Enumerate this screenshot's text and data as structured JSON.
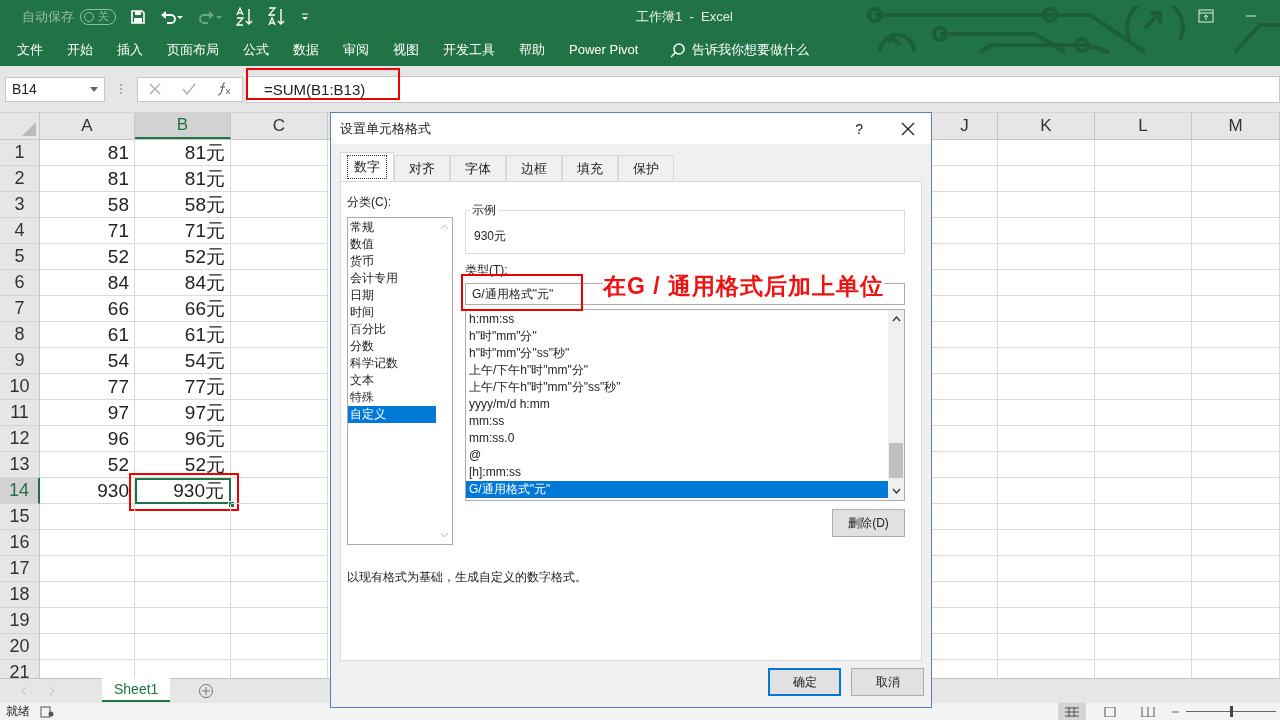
{
  "title_bar": {
    "autosave": {
      "label": "自动保存",
      "state_text": "关",
      "on": false
    },
    "title": "工作簿1  -  Excel"
  },
  "ribbon_tabs": [
    "文件",
    "开始",
    "插入",
    "页面布局",
    "公式",
    "数据",
    "审阅",
    "视图",
    "开发工具",
    "帮助",
    "Power Pivot"
  ],
  "tell_me": "告诉我你想要做什么",
  "formula_bar": {
    "name_box": "B14",
    "formula": "=SUM(B1:B13)"
  },
  "columns": [
    {
      "label": "A",
      "selected": false
    },
    {
      "label": "B",
      "selected": true
    },
    {
      "label": "C",
      "selected": false
    },
    {
      "label": "J",
      "selected": false
    },
    {
      "label": "K",
      "selected": false
    },
    {
      "label": "L",
      "selected": false
    },
    {
      "label": "M",
      "selected": false
    }
  ],
  "rows": [
    {
      "number": "1",
      "selected": false,
      "cells": [
        {
          "text": "81",
          "selected": false
        },
        {
          "text": "81元",
          "selected": false
        }
      ]
    },
    {
      "number": "2",
      "selected": false,
      "cells": [
        {
          "text": "81",
          "selected": false
        },
        {
          "text": "81元",
          "selected": false
        }
      ]
    },
    {
      "number": "3",
      "selected": false,
      "cells": [
        {
          "text": "58",
          "selected": false
        },
        {
          "text": "58元",
          "selected": false
        }
      ]
    },
    {
      "number": "4",
      "selected": false,
      "cells": [
        {
          "text": "71",
          "selected": false
        },
        {
          "text": "71元",
          "selected": false
        }
      ]
    },
    {
      "number": "5",
      "selected": false,
      "cells": [
        {
          "text": "52",
          "selected": false
        },
        {
          "text": "52元",
          "selected": false
        }
      ]
    },
    {
      "number": "6",
      "selected": false,
      "cells": [
        {
          "text": "84",
          "selected": false
        },
        {
          "text": "84元",
          "selected": false
        }
      ]
    },
    {
      "number": "7",
      "selected": false,
      "cells": [
        {
          "text": "66",
          "selected": false
        },
        {
          "text": "66元",
          "selected": false
        }
      ]
    },
    {
      "number": "8",
      "selected": false,
      "cells": [
        {
          "text": "61",
          "selected": false
        },
        {
          "text": "61元",
          "selected": false
        }
      ]
    },
    {
      "number": "9",
      "selected": false,
      "cells": [
        {
          "text": "54",
          "selected": false
        },
        {
          "text": "54元",
          "selected": false
        }
      ]
    },
    {
      "number": "10",
      "selected": false,
      "cells": [
        {
          "text": "77",
          "selected": false
        },
        {
          "text": "77元",
          "selected": false
        }
      ]
    },
    {
      "number": "11",
      "selected": false,
      "cells": [
        {
          "text": "97",
          "selected": false
        },
        {
          "text": "97元",
          "selected": false
        }
      ]
    },
    {
      "number": "12",
      "selected": false,
      "cells": [
        {
          "text": "96",
          "selected": false
        },
        {
          "text": "96元",
          "selected": false
        }
      ]
    },
    {
      "number": "13",
      "selected": false,
      "cells": [
        {
          "text": "52",
          "selected": false
        },
        {
          "text": "52元",
          "selected": false
        }
      ]
    },
    {
      "number": "14",
      "selected": true,
      "cells": [
        {
          "text": "930",
          "selected": false
        },
        {
          "text": "930元",
          "selected": true
        }
      ]
    },
    {
      "number": "15",
      "selected": false,
      "cells": []
    },
    {
      "number": "16",
      "selected": false,
      "cells": []
    },
    {
      "number": "17",
      "selected": false,
      "cells": []
    },
    {
      "number": "18",
      "selected": false,
      "cells": []
    },
    {
      "number": "19",
      "selected": false,
      "cells": []
    },
    {
      "number": "20",
      "selected": false,
      "cells": []
    },
    {
      "number": "21",
      "selected": false,
      "cells": []
    }
  ],
  "dialog": {
    "title": "设置单元格格式",
    "help": "?",
    "tabs": [
      {
        "label": "数字",
        "selected": true
      },
      {
        "label": "对齐",
        "selected": false
      },
      {
        "label": "字体",
        "selected": false
      },
      {
        "label": "边框",
        "selected": false
      },
      {
        "label": "填充",
        "selected": false
      },
      {
        "label": "保护",
        "selected": false
      }
    ],
    "category_label": "分类(C):",
    "categories": [
      {
        "label": "常规",
        "selected": false
      },
      {
        "label": "数值",
        "selected": false
      },
      {
        "label": "货币",
        "selected": false
      },
      {
        "label": "会计专用",
        "selected": false
      },
      {
        "label": "日期",
        "selected": false
      },
      {
        "label": "时间",
        "selected": false
      },
      {
        "label": "百分比",
        "selected": false
      },
      {
        "label": "分数",
        "selected": false
      },
      {
        "label": "科学记数",
        "selected": false
      },
      {
        "label": "文本",
        "selected": false
      },
      {
        "label": "特殊",
        "selected": false
      },
      {
        "label": "自定义",
        "selected": true
      }
    ],
    "sample_label": "示例",
    "sample": "930元",
    "type_label": "类型(T):",
    "type_value": "G/通用格式\"元\"",
    "formats": [
      {
        "text": "h:mm:ss",
        "selected": false
      },
      {
        "text": "h\"时\"mm\"分\"",
        "selected": false
      },
      {
        "text": "h\"时\"mm\"分\"ss\"秒\"",
        "selected": false
      },
      {
        "text": "上午/下午h\"时\"mm\"分\"",
        "selected": false
      },
      {
        "text": "上午/下午h\"时\"mm\"分\"ss\"秒\"",
        "selected": false
      },
      {
        "text": "yyyy/m/d h:mm",
        "selected": false
      },
      {
        "text": "mm:ss",
        "selected": false
      },
      {
        "text": "mm:ss.0",
        "selected": false
      },
      {
        "text": "@",
        "selected": false
      },
      {
        "text": "[h]:mm:ss",
        "selected": false
      },
      {
        "text": "G/通用格式\"元\"",
        "selected": true
      }
    ],
    "delete_button": "删除(D)",
    "description": "以现有格式为基础，生成自定义的数字格式。",
    "ok": "确定",
    "cancel": "取消"
  },
  "annotation": "在G / 通用格式后加上单位",
  "sheet_tabs": [
    {
      "label": "Sheet1",
      "selected": true
    }
  ],
  "status": "就绪",
  "zoom": {
    "level": 0.5
  }
}
